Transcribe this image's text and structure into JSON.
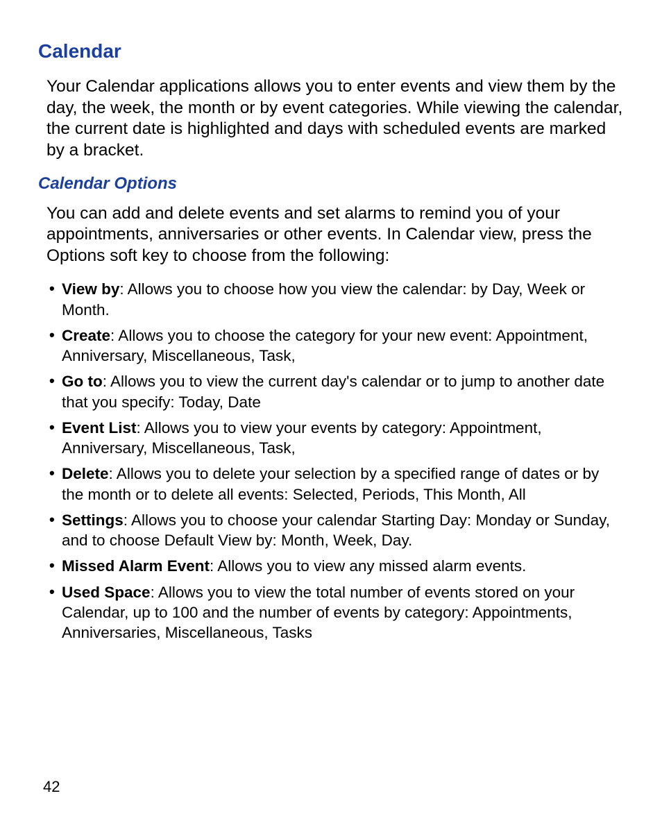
{
  "page_number": "42",
  "heading": "Calendar",
  "intro": "Your Calendar applications allows you to enter events and view them by the day, the week, the month or by event categories. While viewing the calendar, the current date is highlighted and days with scheduled events are marked by a bracket.",
  "sub_heading": "Calendar Options",
  "sub_intro": "You can add and delete events and set alarms to remind you of your appointments, anniversaries or other events. In Calendar view, press the Options soft key to choose from the following:",
  "options": [
    {
      "term": "View by",
      "desc": ": Allows you to choose how you view the calendar: by Day, Week or Month."
    },
    {
      "term": "Create",
      "desc": ": Allows you to choose the category for your new event: Appointment, Anniversary, Miscellaneous, Task,"
    },
    {
      "term": "Go to",
      "desc": ": Allows you to view the current day's calendar or to jump to another date that you specify: Today, Date"
    },
    {
      "term": "Event List",
      "desc": ": Allows you to view your events by category: Appointment, Anniversary, Miscellaneous, Task,"
    },
    {
      "term": "Delete",
      "desc": ": Allows you to delete your selection by a specified range of dates or by the month or to delete all events: Selected, Periods, This Month, All"
    },
    {
      "term": "Settings",
      "desc": ": Allows you to choose your calendar Starting Day: Monday or Sunday, and to choose Default View by: Month, Week, Day."
    },
    {
      "term": "Missed Alarm Event",
      "desc": ": Allows you to view any missed alarm events."
    },
    {
      "term": "Used Space",
      "desc": ": Allows you to view the total number of events stored on your Calendar, up to 100 and the number of events by category: Appointments, Anniversaries, Miscellaneous, Tasks"
    }
  ]
}
